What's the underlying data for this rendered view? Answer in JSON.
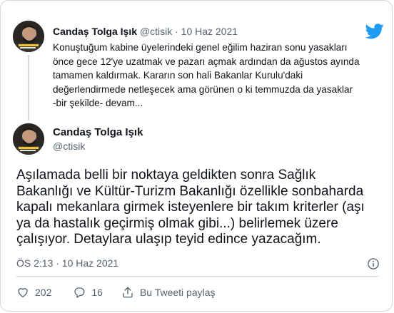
{
  "quoted": {
    "author_name": "Candaş Tolga Işık",
    "handle": "@ctisik",
    "separator": "·",
    "date": "10 Haz 2021",
    "lines": [
      "Konuştuğum kabine üyelerindeki genel eğilim haziran sonu yasakları",
      "önce gece 12'ye uzatmak ve pazarı açmak ardından da ağustos ayında",
      "tamamen kaldırmak. Kararın son hali Bakanlar Kurulu'daki",
      "değerlendirmede netleşecek ama görünen o ki temmuzda da yasaklar",
      "-bir şekilde- devam..."
    ]
  },
  "main": {
    "author_name": "Candaş Tolga Işık",
    "handle": "@ctisik",
    "lines": [
      "Aşılamada belli bir noktaya geldikten sonra Sağlık",
      "Bakanlığı ve Kültür-Turizm Bakanlığı özellikle sonbaharda",
      "kapalı mekanlara girmek isteyenlere bir takım kriterler (aşı",
      "ya da hastalık geçirmiş olmak gibi...) belirlemek üzere",
      "çalışıyor. Detaylara ulaşıp teyid edince yazacağım."
    ],
    "timestamp": "ÖS 2:13 · 10 Haz 2021",
    "likes": "202",
    "replies": "16",
    "share_label": "Bu Tweeti paylaş"
  },
  "colors": {
    "brand": "#1d9bf0",
    "text": "#0f1419",
    "muted": "#536471",
    "border": "#cfd9de"
  },
  "icons": {
    "brand": "twitter-bird-icon",
    "like": "heart-icon",
    "reply": "reply-bubble-icon",
    "share": "share-icon",
    "info": "info-icon"
  }
}
